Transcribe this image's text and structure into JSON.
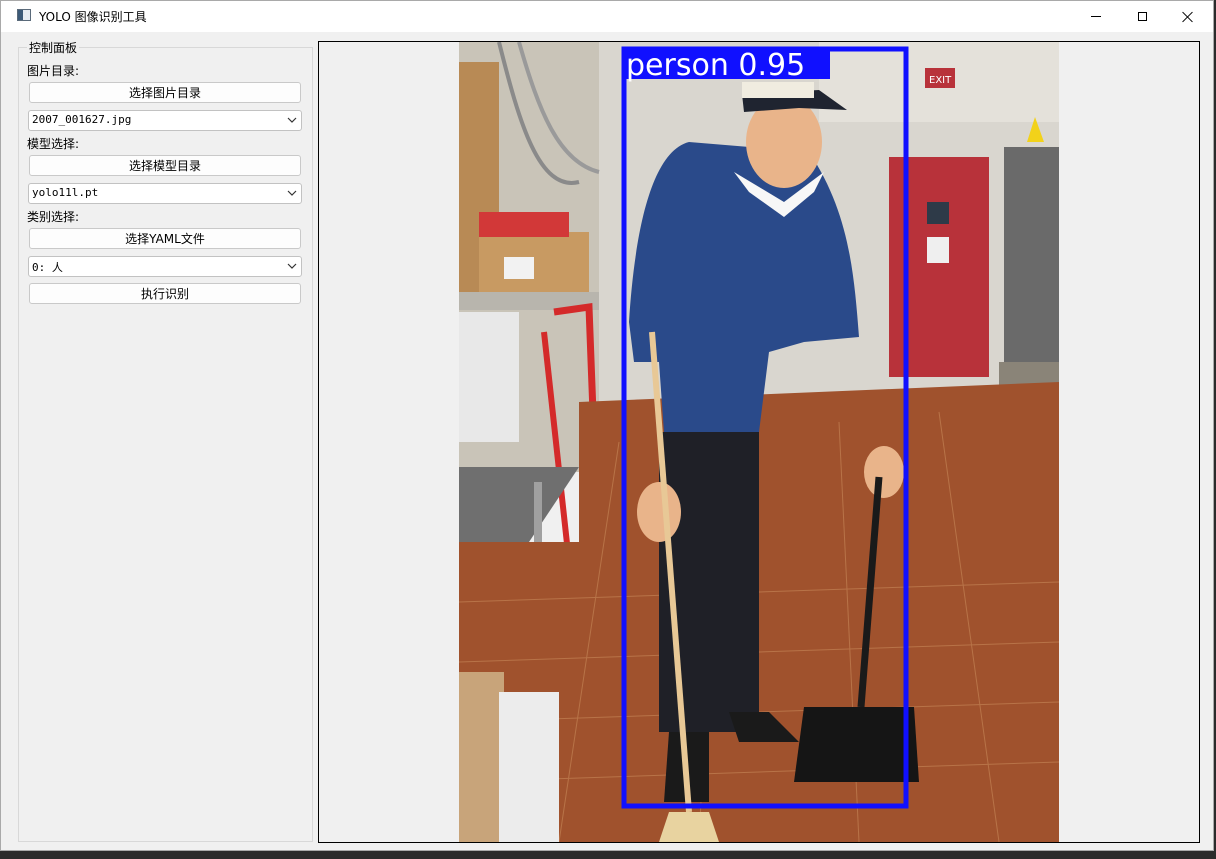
{
  "window": {
    "title": "YOLO 图像识别工具"
  },
  "panel": {
    "group_title": "控制面板",
    "image_dir_label": "图片目录:",
    "select_image_dir_button": "选择图片目录",
    "image_file_value": "2007_001627.jpg",
    "model_label": "模型选择:",
    "select_model_dir_button": "选择模型目录",
    "model_value": "yolo11l.pt",
    "class_label": "类别选择:",
    "select_yaml_button": "选择YAML文件",
    "class_value": "0: 人",
    "run_button": "执行识别"
  },
  "detection": {
    "label": "person 0.95",
    "box_color": "#1010ff"
  },
  "scene": {
    "exit_sign": "EXIT"
  },
  "colors": {
    "window_bg": "#f0f0f0",
    "titlebar_bg": "#ffffff"
  }
}
